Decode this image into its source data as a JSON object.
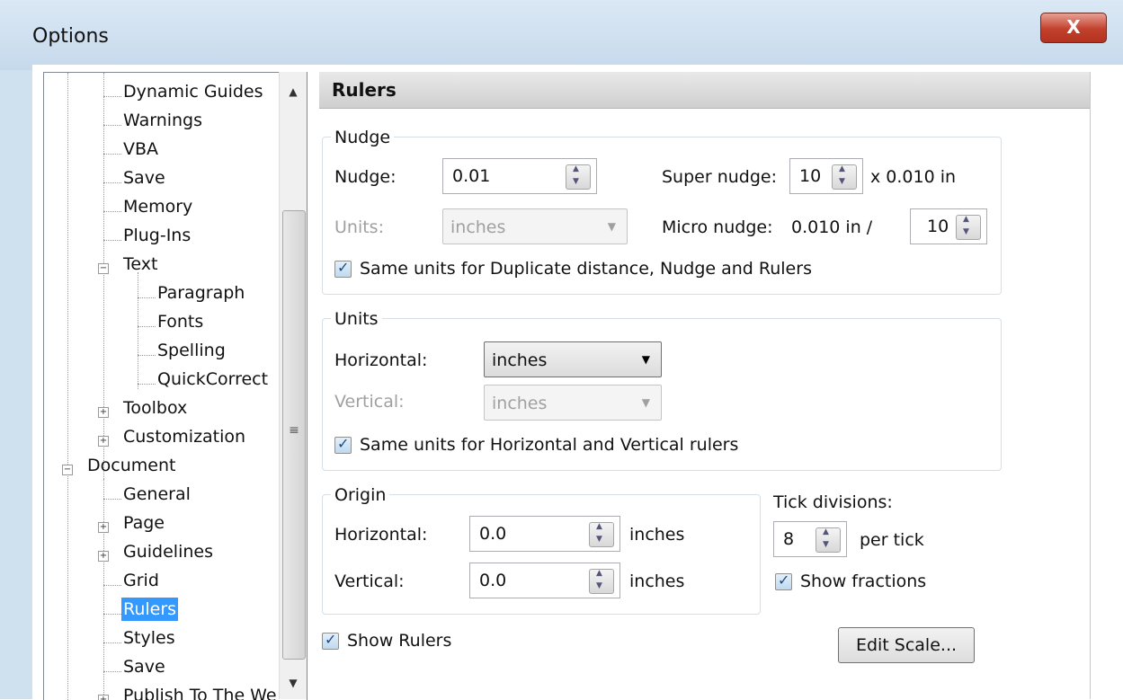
{
  "window": {
    "title": "Options",
    "close_label": "X"
  },
  "tree": {
    "items": [
      {
        "label": "Dynamic Guides"
      },
      {
        "label": "Warnings"
      },
      {
        "label": "VBA"
      },
      {
        "label": "Save"
      },
      {
        "label": "Memory"
      },
      {
        "label": "Plug-Ins"
      },
      {
        "label": "Text"
      },
      {
        "label": "Paragraph"
      },
      {
        "label": "Fonts"
      },
      {
        "label": "Spelling"
      },
      {
        "label": "QuickCorrect"
      },
      {
        "label": "Toolbox"
      },
      {
        "label": "Customization"
      },
      {
        "label": "Document"
      },
      {
        "label": "General"
      },
      {
        "label": "Page"
      },
      {
        "label": "Guidelines"
      },
      {
        "label": "Grid"
      },
      {
        "label": "Rulers"
      },
      {
        "label": "Styles"
      },
      {
        "label": "Save"
      },
      {
        "label": "Publish To The We"
      }
    ],
    "expand_minus": "−",
    "expand_plus": "+",
    "scroll_up": "▲",
    "scroll_down": "▼",
    "grip": "≡"
  },
  "panel": {
    "title": "Rulers",
    "nudge_group": {
      "legend": "Nudge",
      "nudge_label": "Nudge:",
      "nudge_value": "0.01",
      "super_nudge_label": "Super nudge:",
      "super_nudge_value": "10",
      "super_nudge_suffix": "x 0.010 in",
      "units_label": "Units:",
      "units_value": "inches",
      "micro_nudge_label": "Micro nudge:",
      "micro_nudge_text": "0.010 in /",
      "micro_nudge_value": "10",
      "same_units_label": "Same units for Duplicate distance, Nudge and Rulers"
    },
    "units_group": {
      "legend": "Units",
      "horizontal_label": "Horizontal:",
      "horizontal_value": "inches",
      "vertical_label": "Vertical:",
      "vertical_value": "inches",
      "same_units_label": "Same units for Horizontal and Vertical rulers"
    },
    "origin_group": {
      "legend": "Origin",
      "horizontal_label": "Horizontal:",
      "horizontal_value": "0.0",
      "horizontal_unit": "inches",
      "vertical_label": "Vertical:",
      "vertical_value": "0.0",
      "vertical_unit": "inches"
    },
    "tick": {
      "label": "Tick divisions:",
      "value": "8",
      "suffix": "per tick",
      "show_fractions_label": "Show fractions"
    },
    "show_rulers_label": "Show Rulers",
    "edit_scale_label": "Edit Scale..."
  }
}
